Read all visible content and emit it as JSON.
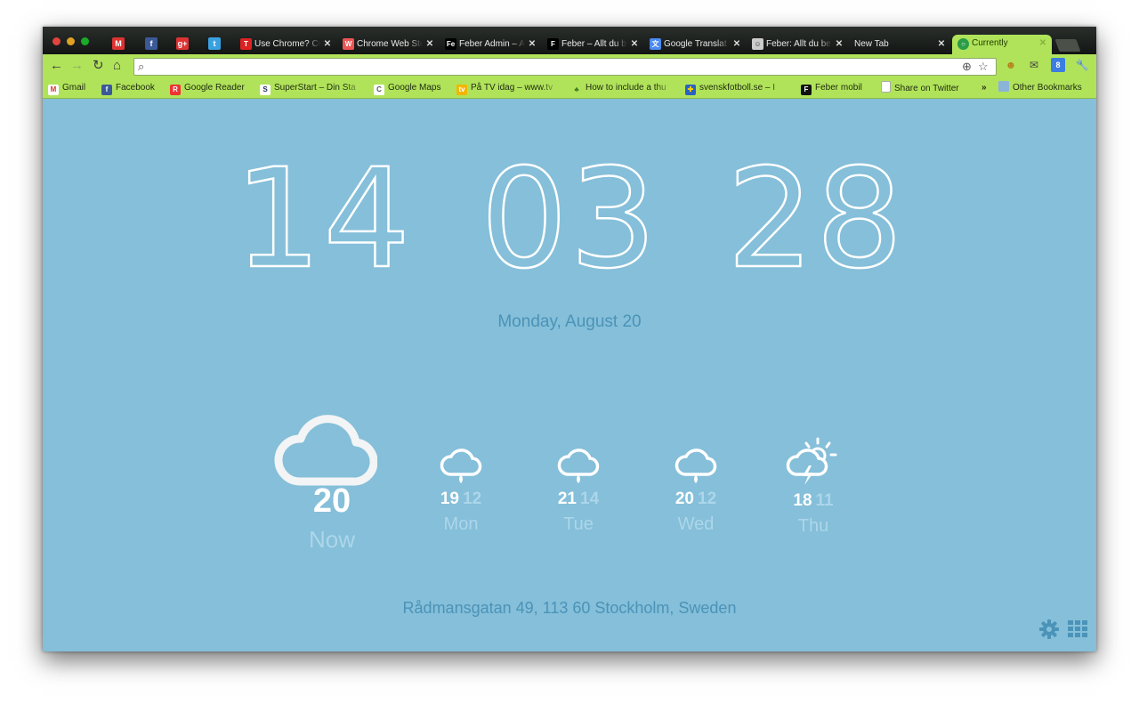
{
  "tabs": [
    {
      "title": "Use Chrome? Cu",
      "favicon": "tmo-icon",
      "color": "#d22"
    },
    {
      "title": "Chrome Web Sto",
      "favicon": "webstore-icon",
      "color": "#e55"
    },
    {
      "title": "Feber Admin – A",
      "favicon": "fe-icon",
      "color": "#000"
    },
    {
      "title": "Feber – Allt du b",
      "favicon": "f-icon",
      "color": "#000"
    },
    {
      "title": "Google Translat",
      "favicon": "translate-icon",
      "color": "#4a8af4"
    },
    {
      "title": "Feber: Allt du be",
      "favicon": "reddit-icon",
      "color": "#ccc"
    },
    {
      "title": "New Tab",
      "favicon": "",
      "color": ""
    },
    {
      "title": "Currently",
      "favicon": "currently-icon",
      "color": "#2a9d46"
    }
  ],
  "bookmarks": [
    {
      "label": "Gmail",
      "icon": "M",
      "color": "#d33"
    },
    {
      "label": "Facebook",
      "icon": "f",
      "color": "#3b5998"
    },
    {
      "label": "Google Reader",
      "icon": "R",
      "color": "#e33"
    },
    {
      "label": "SuperStart – Din Sta",
      "icon": "S",
      "color": "#1a2d60"
    },
    {
      "label": "Google Maps",
      "icon": "C",
      "color": "#666"
    },
    {
      "label": "På TV idag – www.tv",
      "icon": "tv",
      "color": "#e8a400"
    },
    {
      "label": "How to include a thu",
      "icon": "🌵",
      "color": "#3a7a20"
    },
    {
      "label": "svenskfotboll.se – I",
      "icon": "▦",
      "color": "#2b62c2"
    },
    {
      "label": "Feber mobil",
      "icon": "F",
      "color": "#111"
    },
    {
      "label": "Share on Twitter",
      "icon": "▯",
      "color": "#fff"
    }
  ],
  "bookmarks_more": "»",
  "other_bookmarks": "Other Bookmarks",
  "clock": {
    "hours": "14",
    "minutes": "03",
    "seconds": "28"
  },
  "date": "Monday, August 20",
  "weather": {
    "now": {
      "temp": "20",
      "label": "Now",
      "icon": "cloud-icon"
    },
    "forecast": [
      {
        "high": "19",
        "low": "12",
        "day": "Mon",
        "icon": "rain-cloud-icon"
      },
      {
        "high": "21",
        "low": "14",
        "day": "Tue",
        "icon": "rain-cloud-icon"
      },
      {
        "high": "20",
        "low": "12",
        "day": "Wed",
        "icon": "rain-cloud-icon"
      },
      {
        "high": "18",
        "low": "11",
        "day": "Thu",
        "icon": "thunderstorm-sun-icon"
      }
    ]
  },
  "address": "Rådmansgatan 49, 113 60 Stockholm, Sweden",
  "colors": {
    "accent": "#b1e35a",
    "background": "#85bfd9",
    "date_text": "#4b93b8"
  },
  "extension_badge": "8"
}
